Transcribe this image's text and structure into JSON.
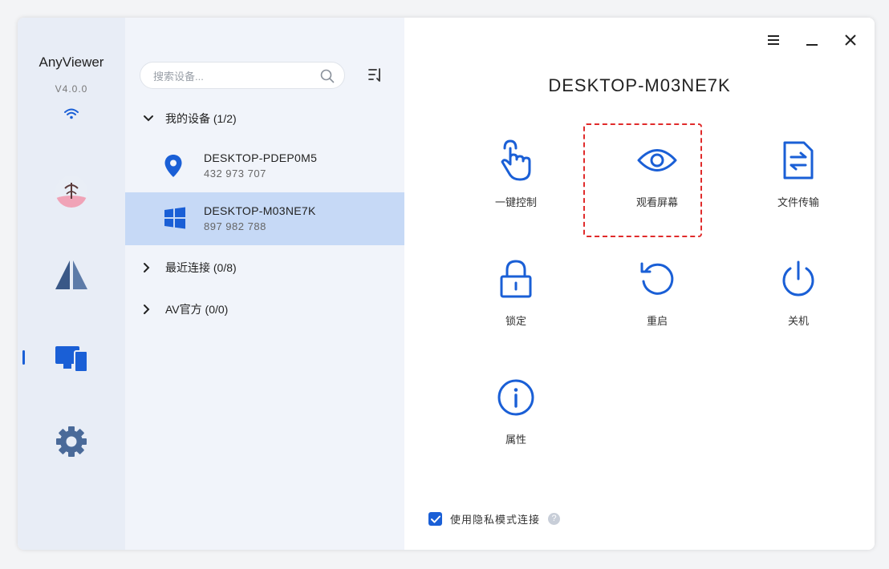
{
  "app": {
    "name": "AnyViewer",
    "version": "V4.0.0"
  },
  "search": {
    "placeholder": "搜索设备..."
  },
  "groups": {
    "my_devices": "我的设备 (1/2)",
    "recent": "最近连接 (0/8)",
    "av_official": "AV官方 (0/0)"
  },
  "devices": [
    {
      "name": "DESKTOP-PDEP0M5",
      "id": "432 973 707",
      "icon": "location-pin-icon"
    },
    {
      "name": "DESKTOP-M03NE7K",
      "id": "897 982 788",
      "icon": "windows-icon"
    }
  ],
  "main": {
    "title": "DESKTOP-M03NE7K",
    "actions": [
      {
        "label": "一键控制",
        "icon": "tap-hand-icon"
      },
      {
        "label": "观看屏幕",
        "icon": "eye-icon"
      },
      {
        "label": "文件传输",
        "icon": "file-transfer-icon"
      },
      {
        "label": "锁定",
        "icon": "lock-icon"
      },
      {
        "label": "重启",
        "icon": "restart-icon"
      },
      {
        "label": "关机",
        "icon": "power-icon"
      },
      {
        "label": "属性",
        "icon": "info-icon"
      }
    ],
    "privacy_label": "使用隐私模式连接",
    "privacy_checked": true
  },
  "colors": {
    "accent": "#1a5fd6",
    "rail_bg": "#e8edf6",
    "list_bg": "#f1f4fa",
    "selected_bg": "#c6d9f6",
    "highlight": "#e02b2b"
  }
}
